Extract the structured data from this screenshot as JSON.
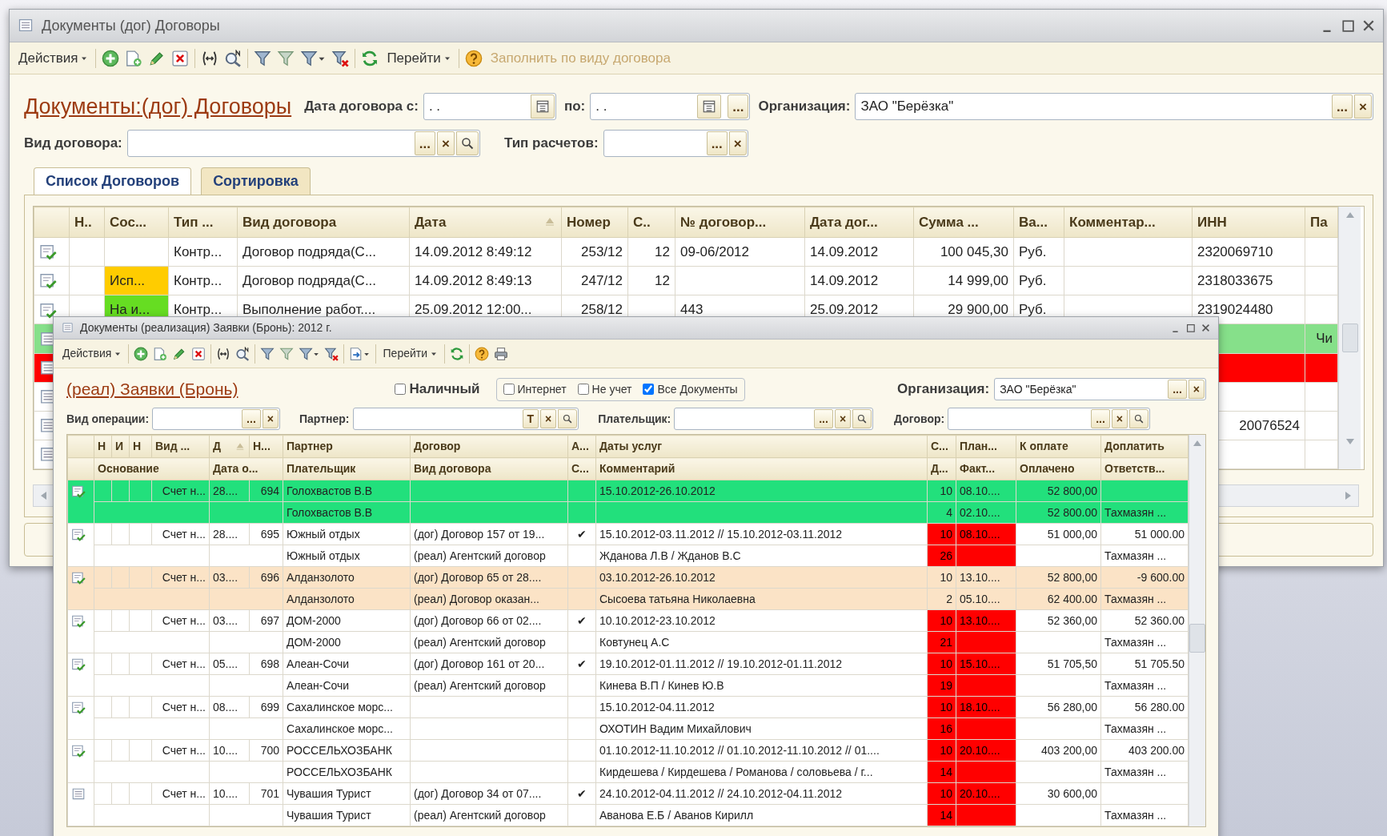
{
  "background_window": {
    "title": "Документы (дог) Договоры",
    "toolbar": {
      "actions": "Действия",
      "goto": "Перейти",
      "fill": {
        "label": "Заполнить по виду договора",
        "disabled": true
      }
    },
    "heading": "Документы:(дог) Договоры",
    "filter_rows": [
      [
        {
          "label": "Дата договора с:",
          "kind": "date",
          "value": ". ."
        },
        {
          "label": "по:",
          "kind": "date",
          "value": ". .",
          "buttons": [
            "..."
          ]
        },
        {
          "label": "Организация:",
          "kind": "ref",
          "value": "ЗАО \"Берёзка\"",
          "buttons": [
            "...",
            "×"
          ],
          "search": false
        }
      ],
      [
        {
          "label": "Вид договора:",
          "kind": "ref",
          "buttons": [
            "...",
            "×"
          ],
          "search": true
        },
        {
          "label": "Тип расчетов:",
          "kind": "ref",
          "buttons": [
            "...",
            "×"
          ],
          "search": false
        }
      ]
    ],
    "tabs": [
      {
        "label": "Список Договоров",
        "selected": true
      },
      {
        "label": "Сортировка",
        "selected": false
      }
    ],
    "table": {
      "columns": [
        {
          "label": "Н..",
          "sorted": false
        },
        {
          "label": "Сос...",
          "sorted": false
        },
        {
          "label": "Тип ...",
          "sorted": false
        },
        {
          "label": "Вид договора",
          "sorted": false
        },
        {
          "label": "Дата",
          "sorted": true
        },
        {
          "label": "Номер",
          "sorted": false
        },
        {
          "label": "С..",
          "sorted": false
        },
        {
          "label": "№ договор...",
          "sorted": false
        },
        {
          "label": "Дата дог...",
          "sorted": false
        },
        {
          "label": "Сумма ...",
          "sorted": false
        },
        {
          "label": "Ва...",
          "sorted": false
        },
        {
          "label": "Комментар...",
          "sorted": false
        },
        {
          "label": "ИНН",
          "sorted": false
        },
        {
          "label": "Па",
          "sorted": false
        }
      ],
      "rows": [
        {
          "kind": "full",
          "posted": true,
          "color": "#ffffff",
          "cells": {
            "type": "Контр...",
            "contract_kind": "Договор подряда(С...",
            "date": "14.09.2012 8:49:12",
            "number": "253/12",
            "column_7": "12",
            "contract_no": "09-06/2012",
            "contract_date": "14.09.2012",
            "amount": "100 045,30",
            "currency": "Руб.",
            "inn": "2320069710"
          }
        },
        {
          "kind": "full",
          "posted": true,
          "color": "#ffffff",
          "cells": {
            "status": {
              "text": "Исп...",
              "color": "#ffcc00"
            },
            "type": "Контр...",
            "contract_kind": "Договор подряда(С...",
            "date": "14.09.2012 8:49:13",
            "number": "247/12",
            "column_7": "12",
            "contract_date": "14.09.2012",
            "amount": "14 999,00",
            "currency": "Руб.",
            "inn": "2318033675"
          }
        },
        {
          "kind": "full",
          "posted": true,
          "color": "#ffffff",
          "cells": {
            "status": {
              "text": "На и...",
              "color": "#66dd22"
            },
            "type": "Контр...",
            "contract_kind": "Выполнение работ....",
            "date": "25.09.2012 12:00...",
            "number": "258/12",
            "contract_no": "443",
            "contract_date": "25.09.2012",
            "amount": "29 900,00",
            "currency": "Руб.",
            "inn": "2319024480"
          }
        },
        {
          "kind": "covered",
          "posted": false,
          "color": "#86e08a",
          "cells": {
            "column_14": "Чи"
          }
        },
        {
          "kind": "covered",
          "posted": false,
          "color": "#ff0000",
          "cells": {}
        },
        {
          "kind": "covered",
          "posted": false,
          "color": "#ffffff",
          "cells": {}
        },
        {
          "kind": "covered",
          "posted": false,
          "color": "#ffffff",
          "cells": {
            "inn": "20076524"
          }
        },
        {
          "kind": "covered",
          "posted": false,
          "color": "#ffffff",
          "cells": {}
        }
      ]
    }
  },
  "front_window": {
    "title": "Документы (реализация) Заявки (Бронь): 2012 г.",
    "toolbar": {
      "actions": "Действия",
      "goto": "Перейти"
    },
    "heading": "(реал) Заявки (Бронь)",
    "options": [
      {
        "label": "Наличный",
        "checked": false,
        "grouped": false
      },
      {
        "label": "Интернет",
        "checked": false,
        "grouped": true
      },
      {
        "label": "Не учет",
        "checked": false,
        "grouped": true
      },
      {
        "label": "Все Документы",
        "checked": true,
        "grouped": true
      }
    ],
    "organization": {
      "label": "Организация:",
      "kind": "ref",
      "value": "ЗАО \"Берёзка\"",
      "buttons": [
        "...",
        "×"
      ],
      "search": false
    },
    "filters": [
      {
        "label": "Вид операции:",
        "kind": "ref",
        "buttons": [
          "...",
          "×"
        ],
        "search": false
      },
      {
        "label": "Партнер:",
        "kind": "ref",
        "buttons": [
          "T",
          "×"
        ],
        "search": true
      },
      {
        "label": "Плательщик:",
        "kind": "ref",
        "buttons": [
          "...",
          "×"
        ],
        "search": true
      },
      {
        "label": "Договор:",
        "kind": "ref",
        "buttons": [
          "...",
          "×"
        ],
        "search": true
      }
    ],
    "table": {
      "columns_top": [
        {
          "label": "Н",
          "sorted": false
        },
        {
          "label": "И",
          "sorted": false
        },
        {
          "label": "Н",
          "sorted": false
        },
        {
          "label": "Вид ...",
          "sorted": false
        },
        {
          "label": "Д",
          "sorted": true
        },
        {
          "label": "Н...",
          "sorted": false
        },
        {
          "label": "Партнер",
          "sorted": false
        },
        {
          "label": "Договор",
          "sorted": false
        },
        {
          "label": "А...",
          "sorted": false
        },
        {
          "label": "Даты услуг",
          "sorted": false
        },
        {
          "label": "С...",
          "sorted": false
        },
        {
          "label": "План...",
          "sorted": false
        },
        {
          "label": "К оплате",
          "sorted": false
        },
        {
          "label": "Доплатить",
          "sorted": false
        }
      ],
      "columns_bottom": [
        "Основание",
        "Дата о...",
        "Плательщик",
        "Вид договора",
        "С...",
        "Комментарий",
        "Д...",
        "Факт...",
        "Оплачено",
        "Ответств..."
      ],
      "records": [
        {
          "posted": true,
          "color": "#22e07c",
          "overdue": false,
          "top": {
            "column_4": "Счет н...",
            "column_5": "28....",
            "column_6": "694",
            "partner": "Голохвастов В.В",
            "service_dates": "15.10.2012-26.10.2012",
            "column_11": "10",
            "column_12": "08.10....",
            "to_pay": "52 800,00"
          },
          "bottom": {
            "payer": "Голохвастов В.В",
            "bottom_7": "4",
            "bottom_8": "02.10....",
            "paid": "52 800.00",
            "bottom_10": "Тахмазян ..."
          }
        },
        {
          "posted": true,
          "color": "#ffffff",
          "overdue": true,
          "top": {
            "column_4": "Счет н...",
            "column_5": "28....",
            "column_6": "695",
            "partner": "Южный отдых",
            "contract": "(дог) Договор 157 от 19...",
            "column_9": "✔",
            "service_dates": "15.10.2012-03.11.2012 // 15.10.2012-03.11.2012",
            "column_11": "10",
            "column_12": "08.10....",
            "to_pay": "51 000,00",
            "extra_payment": "51 000.00"
          },
          "bottom": {
            "payer": "Южный отдых",
            "contract_kind": "(реал) Агентский договор",
            "comment": "Жданова Л.В / Жданов В.С",
            "bottom_7": "26",
            "bottom_10": "Тахмазян ..."
          }
        },
        {
          "posted": true,
          "color": "#fbe3c6",
          "overdue": false,
          "top": {
            "column_4": "Счет н...",
            "column_5": "03....",
            "column_6": "696",
            "partner": "Алданзолото",
            "contract": "(дог) Договор 65 от 28....",
            "service_dates": "03.10.2012-26.10.2012",
            "column_11": "10",
            "column_12": "13.10....",
            "to_pay": "52 800,00",
            "extra_payment": "-9 600.00"
          },
          "bottom": {
            "payer": "Алданзолото",
            "contract_kind": "(реал) Договор оказан...",
            "comment": "Сысоева татьяна Николаевна",
            "bottom_7": "2",
            "bottom_8": "05.10....",
            "paid": "62 400.00",
            "bottom_10": "Тахмазян ..."
          }
        },
        {
          "posted": true,
          "color": "#ffffff",
          "overdue": true,
          "top": {
            "column_4": "Счет н...",
            "column_5": "03....",
            "column_6": "697",
            "partner": "ДОМ-2000",
            "contract": "(дог) Договор 66 от 02....",
            "column_9": "✔",
            "service_dates": "10.10.2012-23.10.2012",
            "column_11": "10",
            "column_12": "13.10....",
            "to_pay": "52 360,00",
            "extra_payment": "52 360.00"
          },
          "bottom": {
            "payer": "ДОМ-2000",
            "contract_kind": "(реал) Агентский договор",
            "comment": "Ковтунец А.С",
            "bottom_7": "21",
            "bottom_10": "Тахмазян ..."
          }
        },
        {
          "posted": true,
          "color": "#ffffff",
          "overdue": true,
          "top": {
            "column_4": "Счет н...",
            "column_5": "05....",
            "column_6": "698",
            "partner": "Алеан-Сочи",
            "contract": "(дог) Договор 161 от 20...",
            "column_9": "✔",
            "service_dates": "19.10.2012-01.11.2012 // 19.10.2012-01.11.2012",
            "column_11": "10",
            "column_12": "15.10....",
            "to_pay": "51 705,50",
            "extra_payment": "51 705.50"
          },
          "bottom": {
            "payer": "Алеан-Сочи",
            "contract_kind": "(реал) Агентский договор",
            "comment": "Кинева В.П / Кинев Ю.В",
            "bottom_7": "19",
            "bottom_10": "Тахмазян ..."
          }
        },
        {
          "posted": true,
          "color": "#ffffff",
          "overdue": true,
          "top": {
            "column_4": "Счет н...",
            "column_5": "08....",
            "column_6": "699",
            "partner": "Сахалинское морс...",
            "service_dates": "15.10.2012-04.11.2012",
            "column_11": "10",
            "column_12": "18.10....",
            "to_pay": "56 280,00",
            "extra_payment": "56 280.00"
          },
          "bottom": {
            "payer": "Сахалинское морс...",
            "comment": "ОХОТИН Вадим Михайлович",
            "bottom_7": "16",
            "bottom_10": "Тахмазян ..."
          }
        },
        {
          "posted": true,
          "color": "#ffffff",
          "overdue": true,
          "top": {
            "column_4": "Счет н...",
            "column_5": "10....",
            "column_6": "700",
            "partner": "РОССЕЛЬХОЗБАНК",
            "service_dates": "01.10.2012-11.10.2012 // 01.10.2012-11.10.2012 // 01....",
            "column_11": "10",
            "column_12": "20.10....",
            "to_pay": "403 200,00",
            "extra_payment": "403 200.00"
          },
          "bottom": {
            "payer": "РОССЕЛЬХОЗБАНК",
            "comment": "Кирдешева / Кирдешева / Романова / соловьева / г...",
            "bottom_7": "14",
            "bottom_10": "Тахмазян ..."
          }
        },
        {
          "posted": false,
          "color": "#ffffff",
          "overdue": true,
          "top": {
            "column_4": "Счет н...",
            "column_5": "10....",
            "column_6": "701",
            "partner": "Чувашия Турист",
            "contract": "(дог) Договор 34 от 07....",
            "column_9": "✔",
            "service_dates": "24.10.2012-04.11.2012 // 24.10.2012-04.11.2012",
            "column_11": "10",
            "column_12": "20.10....",
            "to_pay": "30 600,00"
          },
          "bottom": {
            "payer": "Чувашия Турист",
            "contract_kind": "(реал) Агентский договор",
            "comment": "Аванова Е.Б / Аванов Кирилл",
            "bottom_7": "14",
            "bottom_10": "Тахмазян ..."
          }
        }
      ]
    }
  }
}
